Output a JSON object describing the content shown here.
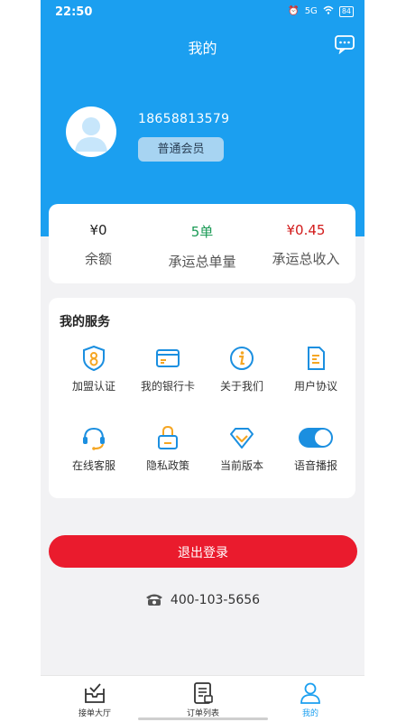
{
  "status_bar": {
    "time": "22:50",
    "network": "5G",
    "battery": "84"
  },
  "header": {
    "title": "我的"
  },
  "profile": {
    "phone": "18658813579",
    "member_level": "普通会员"
  },
  "stats": [
    {
      "value": "¥0",
      "label": "余额",
      "color": "#222222"
    },
    {
      "value": "5单",
      "label": "承运总单量",
      "color": "#1a9a55"
    },
    {
      "value": "¥0.45",
      "label": "承运总收入",
      "color": "#d21b1b"
    }
  ],
  "services": {
    "title": "我的服务",
    "items": [
      {
        "label": "加盟认证",
        "icon": "shield-certification-icon"
      },
      {
        "label": "我的银行卡",
        "icon": "bank-card-icon"
      },
      {
        "label": "关于我们",
        "icon": "info-icon"
      },
      {
        "label": "用户协议",
        "icon": "document-icon"
      },
      {
        "label": "在线客服",
        "icon": "headset-icon"
      },
      {
        "label": "隐私政策",
        "icon": "lock-icon"
      },
      {
        "label": "当前版本",
        "icon": "diamond-icon"
      },
      {
        "label": "语音播报",
        "icon": "toggle-icon",
        "enabled": true
      }
    ]
  },
  "logout": {
    "label": "退出登录"
  },
  "hotline": {
    "number": "400-103-5656"
  },
  "tabs": [
    {
      "label": "接单大厅",
      "icon": "order-hall-icon",
      "active": false
    },
    {
      "label": "订单列表",
      "icon": "order-list-icon",
      "active": false
    },
    {
      "label": "我的",
      "icon": "user-icon",
      "active": true
    }
  ],
  "colors": {
    "brand_blue": "#1b9ff0",
    "logout_red": "#ea1b2d",
    "icon_orange": "#f5a623",
    "icon_blue": "#1b8fe0"
  }
}
